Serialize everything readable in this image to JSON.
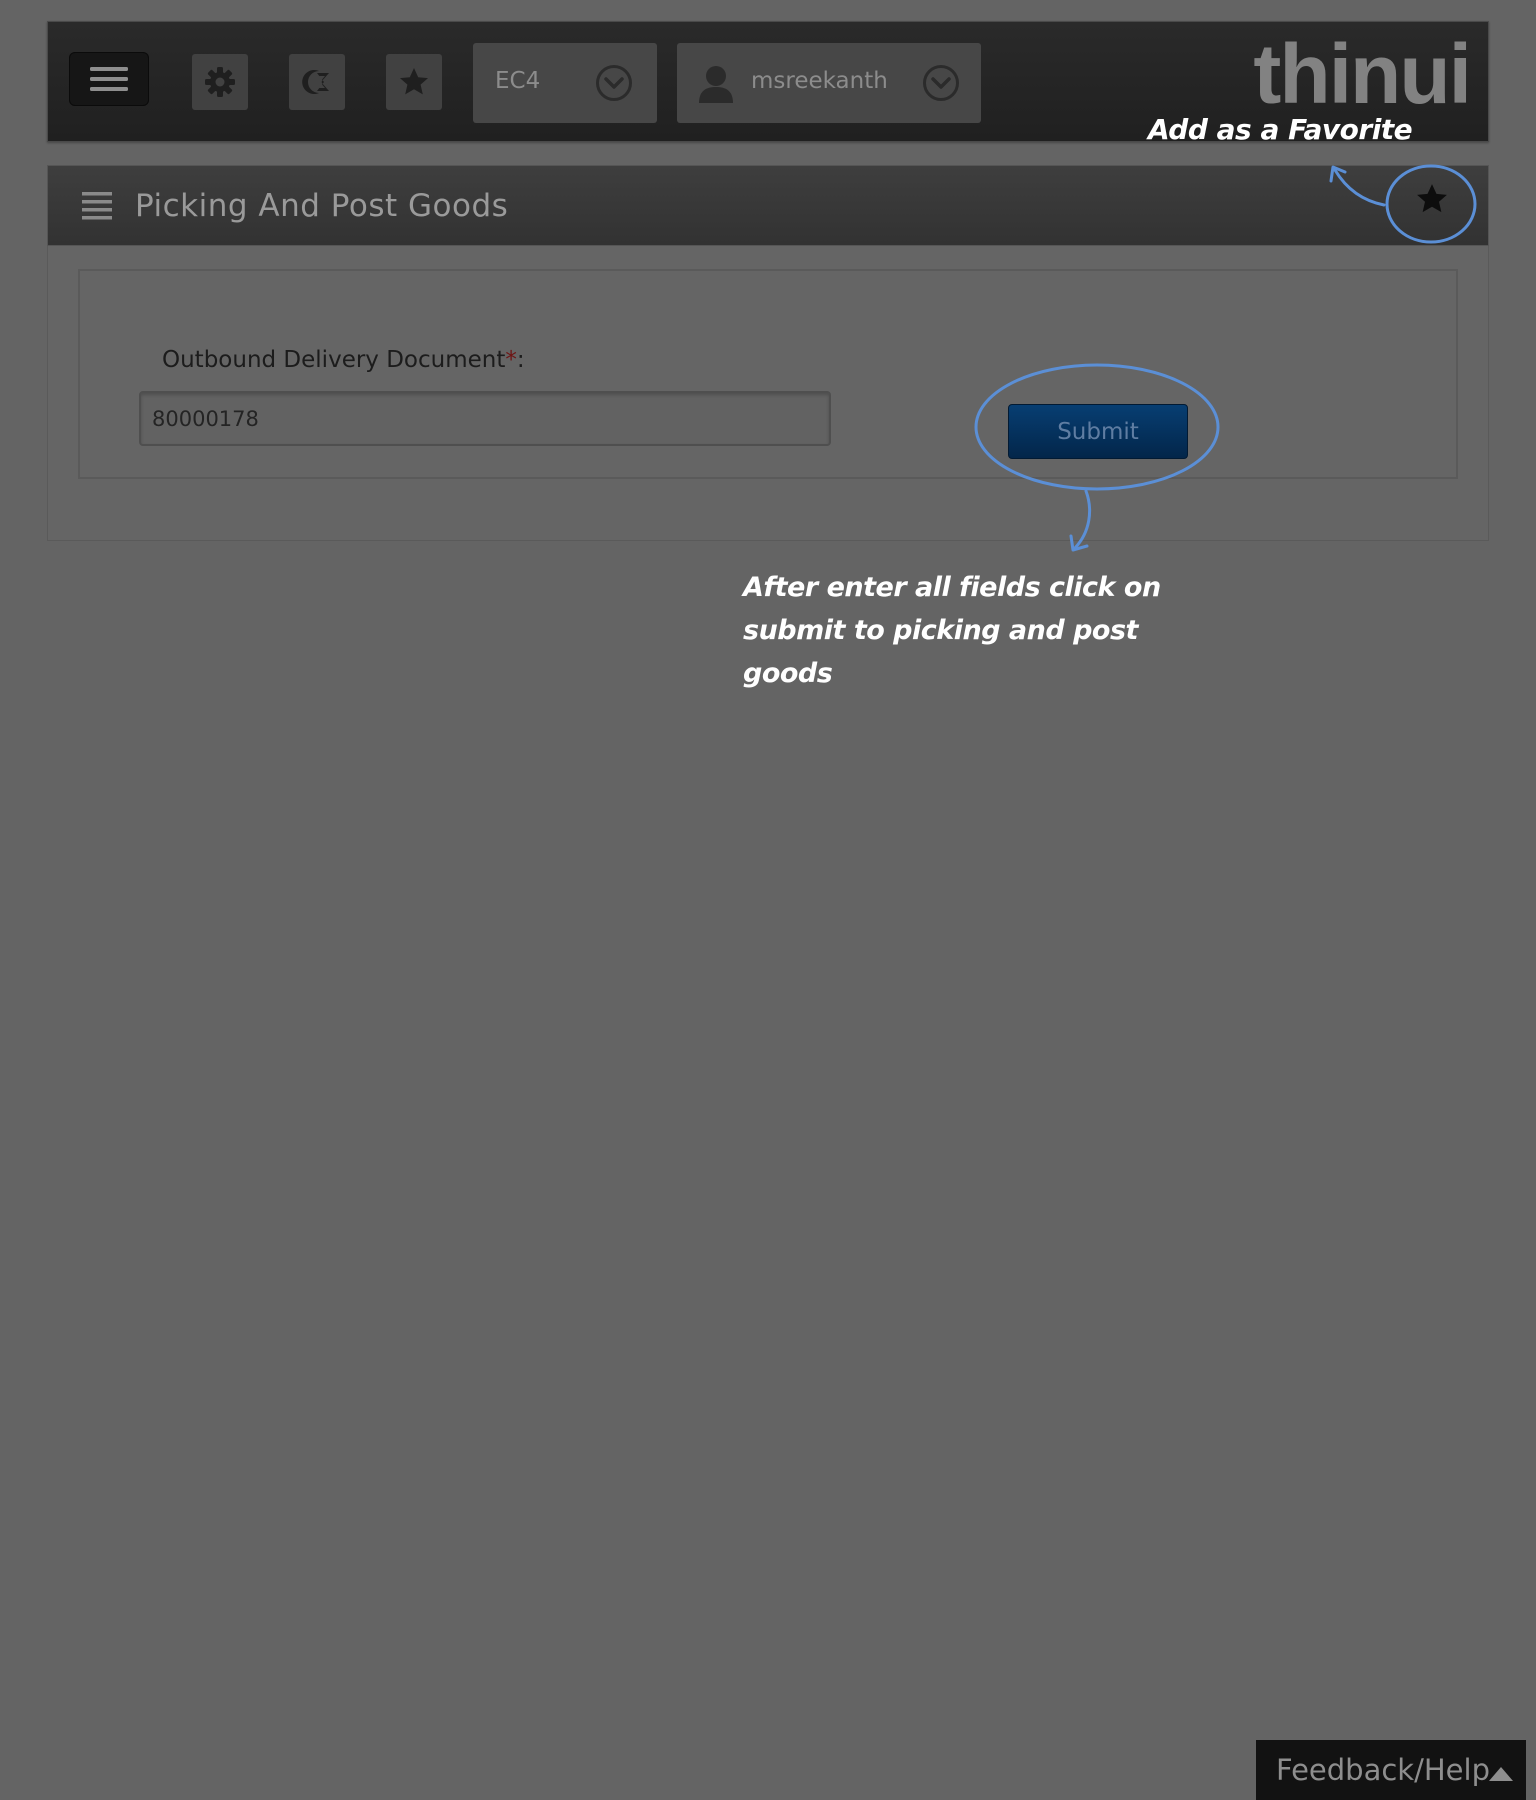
{
  "header": {
    "system": "EC4",
    "username": "msreekanth",
    "logo": "thinui",
    "icons": {
      "menu": "hamburger-menu-icon",
      "settings": "gear-icon",
      "language": "language-icon",
      "favorites": "star-icon",
      "user": "user-icon",
      "dropdown": "chevron-down-circle-icon"
    }
  },
  "page": {
    "title": "Picking And Post Goods"
  },
  "form": {
    "field_label": "Outbound Delivery Document",
    "required_mark": "*",
    "label_suffix": ":",
    "field_value": "80000178",
    "submit_label": "Submit"
  },
  "annotations": {
    "favorite": "Add as a Favorite",
    "submit_line1": "After enter all fields click on",
    "submit_line2": "submit to picking and post goods",
    "accent_color": "#5b8fd6"
  },
  "footer": {
    "feedback_label": "Feedback/Help"
  },
  "colors": {
    "overlay_background": "#646464",
    "submit_button": "#063a6c",
    "required_star": "#6e1414"
  }
}
